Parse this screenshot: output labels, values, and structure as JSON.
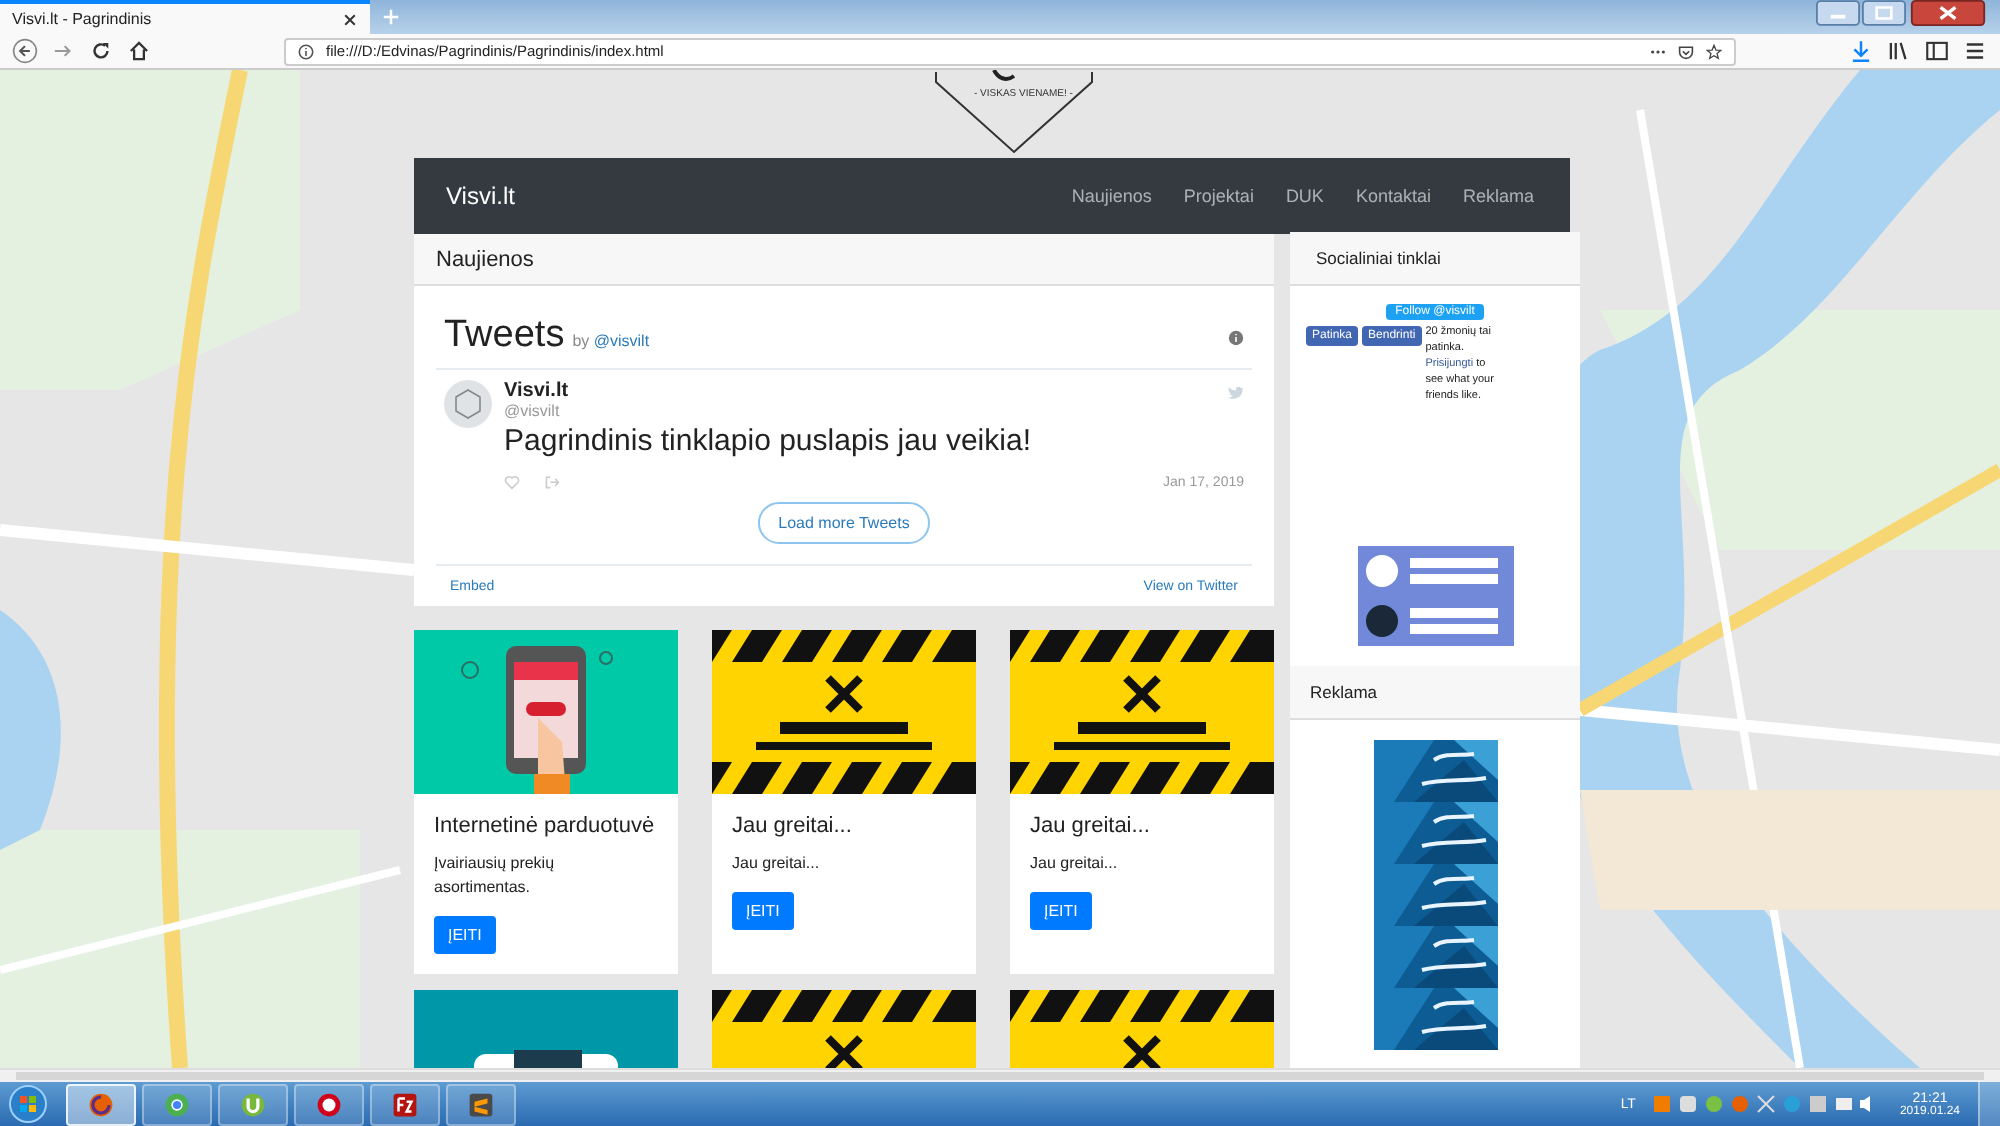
{
  "browser": {
    "tab_title": "Visvi.lt - Pagrindinis",
    "url": "file:///D:/Edvinas/Pagrindinis/Pagrindinis/index.html"
  },
  "site": {
    "slogan": "- VISKAS VIENAME! -",
    "brand": "Visvi.lt",
    "nav": [
      "Naujienos",
      "Projektai",
      "DUK",
      "Kontaktai",
      "Reklama"
    ]
  },
  "news": {
    "heading": "Naujienos",
    "timeline": {
      "title": "Tweets",
      "by": "by",
      "handle": "@visvilt",
      "tweet": {
        "name": "Visvi.lt",
        "handle": "@visvilt",
        "text": "Pagrindinis tinklapio puslapis jau veikia!",
        "date": "Jan 17, 2019"
      },
      "load_more": "Load more Tweets",
      "embed": "Embed",
      "view_on": "View on Twitter"
    }
  },
  "cards": [
    {
      "kind": "shop",
      "title": "Internetinė parduotuvė",
      "text": "Įvairiausių prekių asortimentas.",
      "button": "ĮEITI"
    },
    {
      "kind": "construction",
      "title": "Jau greitai...",
      "text": "Jau greitai...",
      "button": "ĮEITI"
    },
    {
      "kind": "construction",
      "title": "Jau greitai...",
      "text": "Jau greitai...",
      "button": "ĮEITI"
    },
    {
      "kind": "car"
    },
    {
      "kind": "construction"
    },
    {
      "kind": "construction"
    }
  ],
  "social": {
    "heading": "Socialiniai tinklai",
    "follow": "Follow @visvilt",
    "like": "Patinka",
    "share": "Bendrinti",
    "like_text": "20 žmonių tai patinka.",
    "login_link": "Prisijungti",
    "login_rest": "to see what your friends like."
  },
  "ads": {
    "heading": "Reklama"
  },
  "taskbar": {
    "apps": [
      {
        "kind": "firefox",
        "selected": true
      },
      {
        "kind": "chrome",
        "selected": false
      },
      {
        "kind": "torrent",
        "selected": false
      },
      {
        "kind": "opera",
        "selected": false
      },
      {
        "kind": "filezilla",
        "selected": false
      },
      {
        "kind": "sublime",
        "selected": false
      }
    ],
    "language": "LT",
    "time": "21:21",
    "date": "2019.01.24"
  }
}
